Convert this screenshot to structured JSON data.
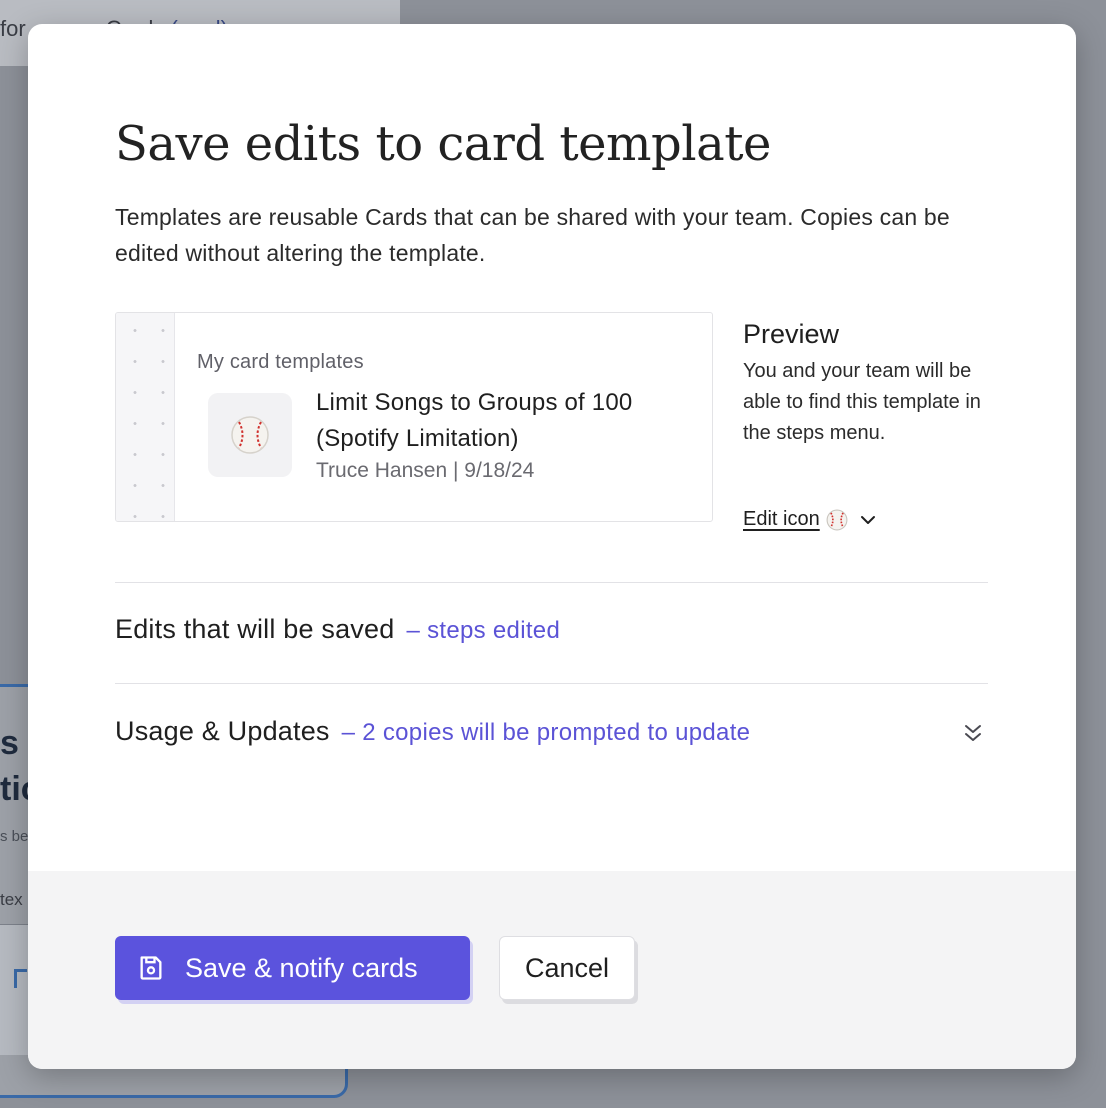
{
  "background": {
    "topbar_text": "for",
    "topbar_text_2": "Cards",
    "topbar_link": "(card)",
    "left_title": "s to\ntio",
    "left_small": "s be",
    "left_text": "tex"
  },
  "modal": {
    "title": "Save edits to card template",
    "description": "Templates are reusable Cards that can be shared with your team. Copies can be edited without altering the template."
  },
  "template_card": {
    "group_label": "My card templates",
    "emoji": "⚾",
    "title": "Limit Songs to Groups of 100 (Spotify Limitation)",
    "author": "Truce Hansen",
    "separator": "|",
    "date": "9/18/24"
  },
  "preview": {
    "heading": "Preview",
    "text": "You and your team will be able to find this template in the steps menu.",
    "edit_icon_label": "Edit icon",
    "edit_icon_emoji": "⚾"
  },
  "sections": {
    "edits_title": "Edits that will be saved",
    "edits_note": "– steps edited",
    "usage_title": "Usage & Updates",
    "usage_note": "– 2 copies will be prompted to update"
  },
  "footer": {
    "save_label": "Save & notify cards",
    "cancel_label": "Cancel"
  },
  "colors": {
    "accent": "#5b53dd",
    "note_text": "#5b53d6",
    "overlay": "#8d9199"
  }
}
